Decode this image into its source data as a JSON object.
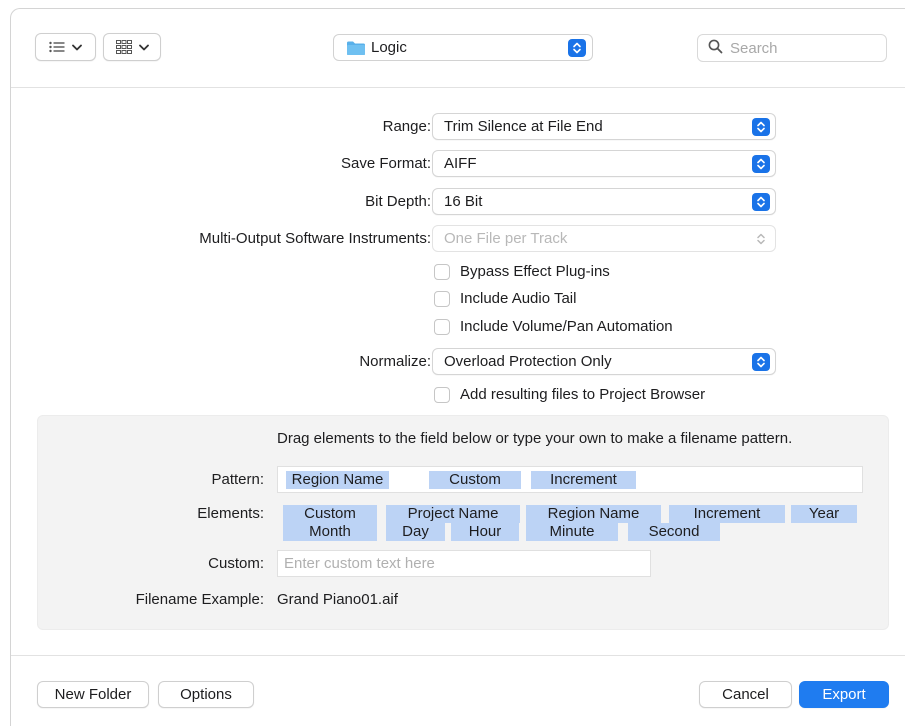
{
  "toolbar": {
    "view_list_icon": "list-icon",
    "view_grid_icon": "grid-icon",
    "location_label": "Logic",
    "search_placeholder": "Search"
  },
  "form": {
    "range": {
      "label": "Range:",
      "value": "Trim Silence at File End"
    },
    "save_format": {
      "label": "Save Format:",
      "value": "AIFF"
    },
    "bit_depth": {
      "label": "Bit Depth:",
      "value": "16 Bit"
    },
    "multi_output": {
      "label": "Multi-Output Software Instruments:",
      "value": "One File per Track"
    },
    "checkboxes": [
      {
        "label": "Bypass Effect Plug-ins",
        "checked": false
      },
      {
        "label": "Include Audio Tail",
        "checked": false
      },
      {
        "label": "Include Volume/Pan Automation",
        "checked": false
      }
    ],
    "normalize": {
      "label": "Normalize:",
      "value": "Overload Protection Only"
    },
    "add_to_browser": {
      "label": "Add resulting files to Project Browser",
      "checked": false
    }
  },
  "filename": {
    "hint": "Drag elements to the field below or type your own to make a filename pattern.",
    "pattern_label": "Pattern:",
    "pattern_tokens": [
      "Region Name",
      "Custom",
      "Increment"
    ],
    "elements_label": "Elements:",
    "element_tokens": [
      "Custom",
      "Project Name",
      "Region Name",
      "Increment",
      "Year",
      "Month",
      "Day",
      "Hour",
      "Minute",
      "Second"
    ],
    "custom_label": "Custom:",
    "custom_placeholder": "Enter custom text here",
    "example_label": "Filename Example:",
    "example_value": "Grand Piano01.aif"
  },
  "buttons": {
    "new_folder": "New Folder",
    "options": "Options",
    "cancel": "Cancel",
    "export": "Export"
  },
  "colors": {
    "accent": "#1f7cf0",
    "token": "#bcd3f5",
    "panel_bg": "#f3f3f3"
  }
}
